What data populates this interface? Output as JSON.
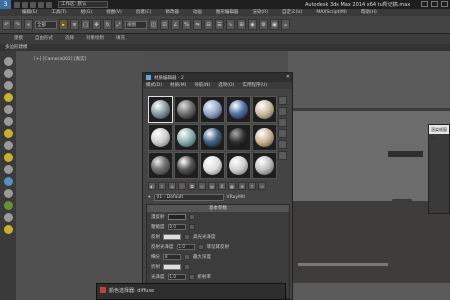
{
  "titlebar": {
    "workspace": "工作区: 默认",
    "title": "Autodesk 3ds Max  2014 x64",
    "filename": "tu所记搞.max"
  },
  "menubar": {
    "items": [
      "编辑(E)",
      "工具(T)",
      "组(G)",
      "视图(V)",
      "创建(C)",
      "修改器",
      "动画",
      "图形编辑器",
      "渲染(R)",
      "自定义(U)",
      "MAXScript(M)",
      "帮助(H)"
    ]
  },
  "toolbar": {
    "select_filter": "全部",
    "view_dropdown": "视图"
  },
  "ribbon": {
    "items": [
      "建模",
      "自由形式",
      "选择",
      "对象绘制",
      "填充"
    ]
  },
  "subbar": {
    "label": "多边形建模"
  },
  "viewport": {
    "label": "[+] [Camera002] [真实]"
  },
  "material_editor": {
    "title": "材质编辑器 - 2",
    "menu": [
      "模式(D)",
      "材质(M)",
      "导航(N)",
      "选项(O)",
      "实用程序(U)"
    ],
    "material_name": "01 - Default",
    "material_type": "VRayMtl",
    "rollout_title": "基本参数",
    "rows": [
      {
        "label": "漫反射",
        "value": "",
        "extra": ""
      },
      {
        "label": "粗糙度",
        "value": "0.0",
        "extra": ""
      },
      {
        "label": "反射",
        "value": "",
        "extra": "高光光泽度"
      },
      {
        "label": "反射光泽度",
        "value": "1.0",
        "extra": "菲涅耳反射"
      },
      {
        "label": "细分",
        "value": "8",
        "extra": "最大深度"
      },
      {
        "label": "折射",
        "value": "",
        "extra": ""
      },
      {
        "label": "光泽度",
        "value": "1.0",
        "extra": "折射率"
      },
      {
        "label": "细分",
        "value": "8",
        "extra": "最大深度"
      }
    ]
  },
  "color_dialog": {
    "title": "颜色选择器: diffuse"
  },
  "floating_panel": {
    "title": "渲染帧窗口"
  },
  "colors": {
    "accent": "#6ba4d8"
  }
}
